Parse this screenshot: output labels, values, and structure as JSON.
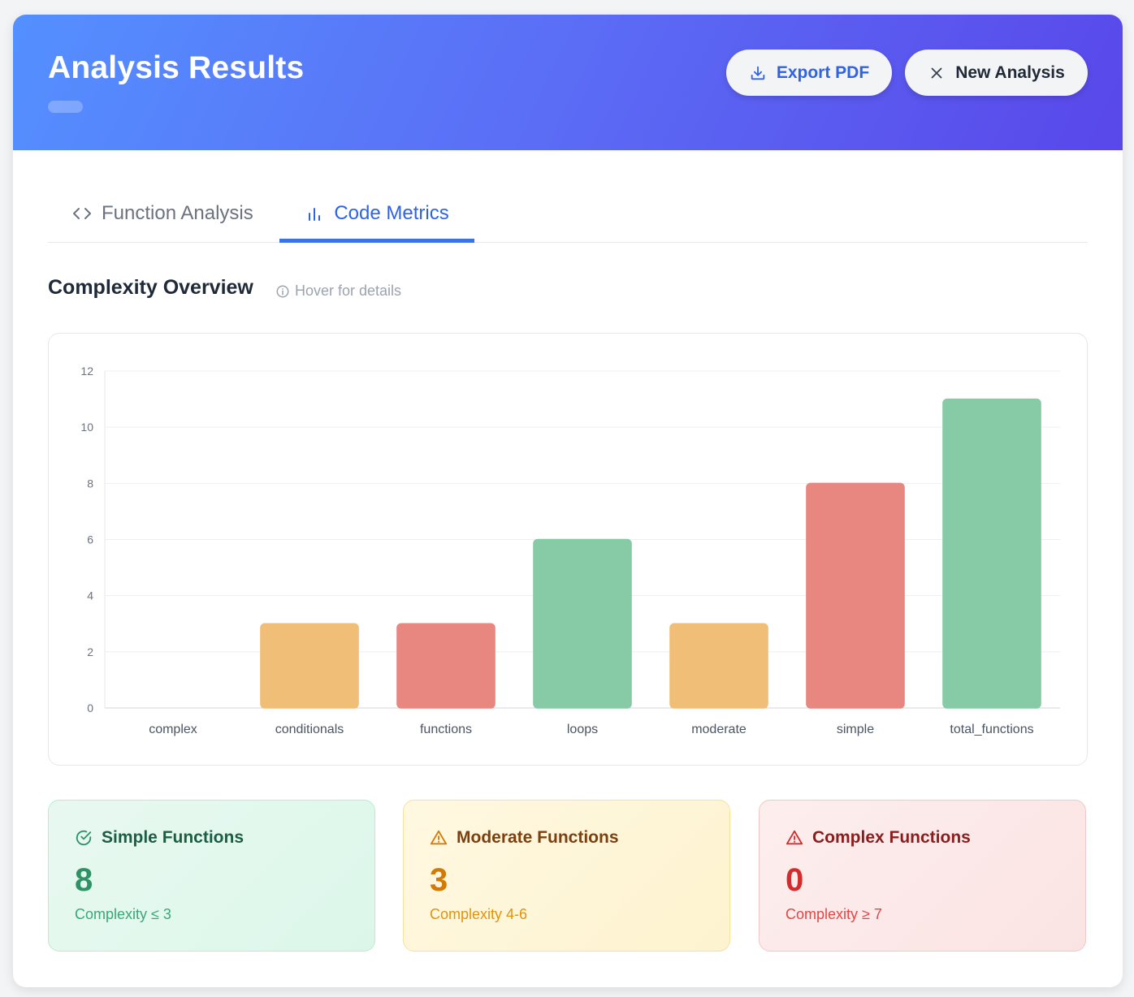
{
  "header": {
    "title": "Analysis Results",
    "export_label": "Export PDF",
    "new_label": "New Analysis"
  },
  "tabs": [
    {
      "label": "Function Analysis",
      "icon": "code-icon",
      "active": false
    },
    {
      "label": "Code Metrics",
      "icon": "bar-chart-icon",
      "active": true
    }
  ],
  "section": {
    "title": "Complexity Overview",
    "hint": "Hover for details"
  },
  "colors": {
    "green": "#86cba5",
    "orange": "#f0be77",
    "red": "#e88680",
    "accent": "#3b72ea"
  },
  "chart_data": {
    "type": "bar",
    "categories": [
      "complex",
      "conditionals",
      "functions",
      "loops",
      "moderate",
      "simple",
      "total_functions"
    ],
    "values": [
      0,
      3,
      3,
      6,
      3,
      8,
      11
    ],
    "bar_colors": [
      "#e88680",
      "#f0be77",
      "#e88680",
      "#86cba5",
      "#f0be77",
      "#e88680",
      "#86cba5"
    ],
    "ylim": [
      0,
      12
    ],
    "yticks": [
      0,
      2,
      4,
      6,
      8,
      10,
      12
    ],
    "grid": true,
    "title": "",
    "xlabel": "",
    "ylabel": ""
  },
  "stats": {
    "simple": {
      "title": "Simple Functions",
      "value": "8",
      "note": "Complexity ≤ 3",
      "icon": "check-circle-icon"
    },
    "moderate": {
      "title": "Moderate Functions",
      "value": "3",
      "note": "Complexity 4-6",
      "icon": "warning-icon"
    },
    "complex": {
      "title": "Complex Functions",
      "value": "0",
      "note": "Complexity ≥ 7",
      "icon": "warning-icon"
    }
  }
}
